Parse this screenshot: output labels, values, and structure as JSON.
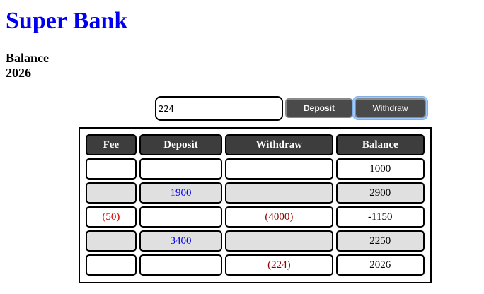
{
  "app": {
    "title": "Super Bank",
    "balance_label": "Balance",
    "balance_value": "2026"
  },
  "form": {
    "amount_value": "224",
    "deposit_label": "Deposit",
    "withdraw_label": "Withdraw"
  },
  "table": {
    "headers": {
      "fee": "Fee",
      "deposit": "Deposit",
      "withdraw": "Withdraw",
      "balance": "Balance"
    },
    "rows": [
      {
        "fee": "",
        "deposit": "",
        "withdraw": "",
        "balance": "1000"
      },
      {
        "fee": "",
        "deposit": "1900",
        "withdraw": "",
        "balance": "2900"
      },
      {
        "fee": "(50)",
        "deposit": "",
        "withdraw": "(4000)",
        "balance": "-1150"
      },
      {
        "fee": "",
        "deposit": "3400",
        "withdraw": "",
        "balance": "2250"
      },
      {
        "fee": "",
        "deposit": "",
        "withdraw": "(224)",
        "balance": "2026"
      }
    ]
  },
  "colors": {
    "title": "#0000ee",
    "deposit_text": "#0000ee",
    "fee_text": "#cc0000",
    "withdraw_text": "#8b0000",
    "header_bg": "#3d3d3d",
    "alt_row_bg": "#e0e0e0"
  }
}
